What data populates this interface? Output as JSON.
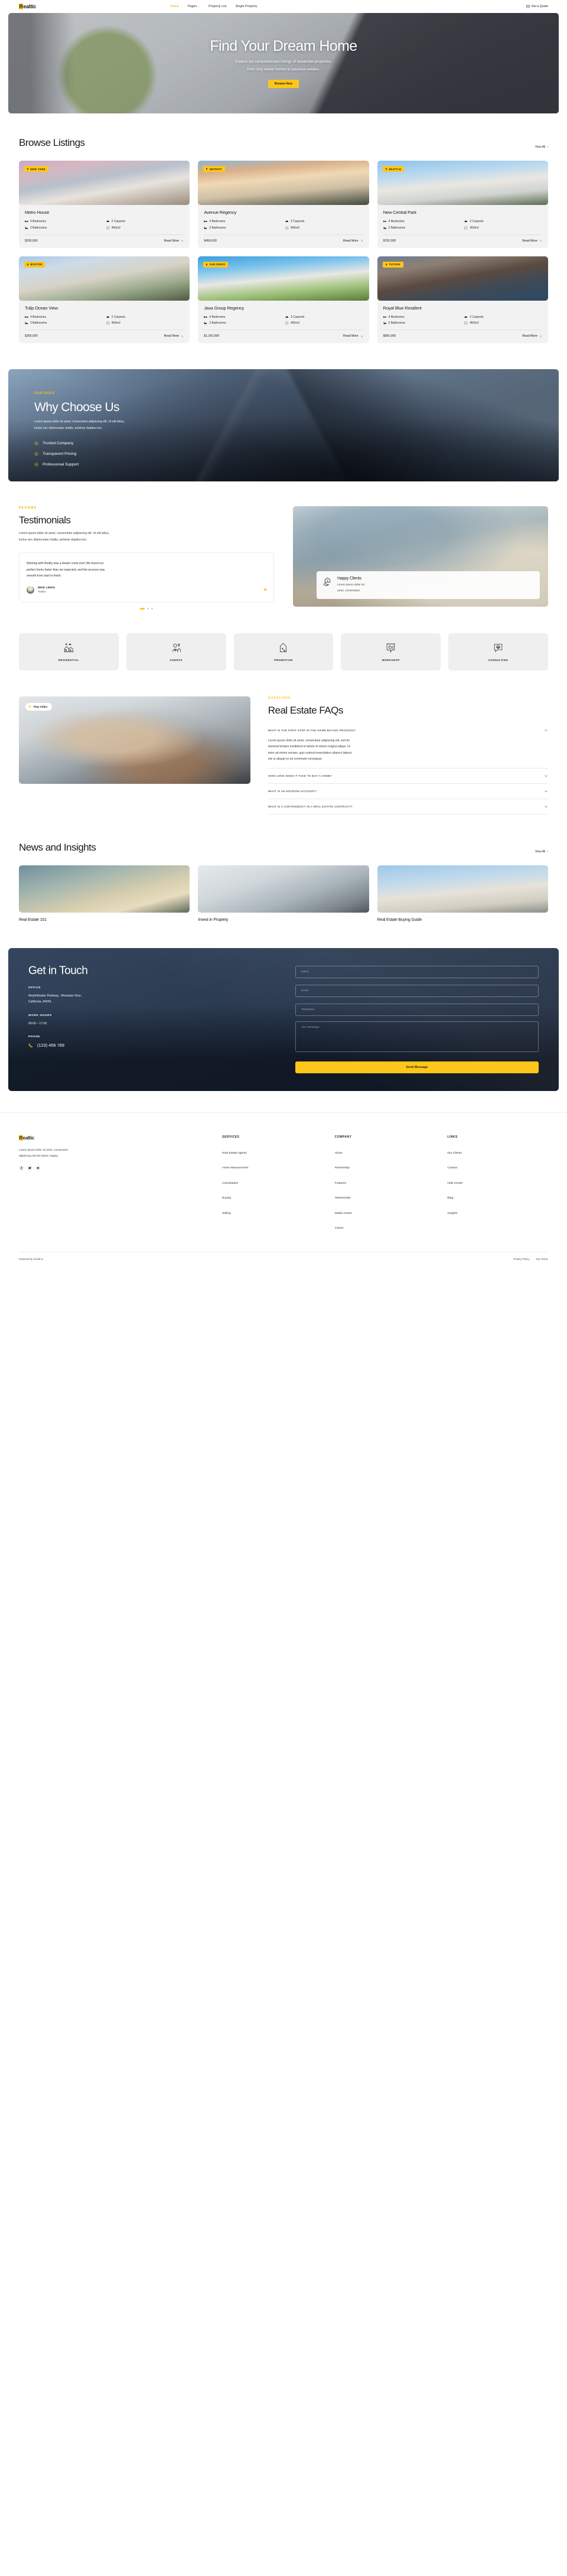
{
  "brand": {
    "name_highlight": "R",
    "name_rest": "ealtic"
  },
  "header": {
    "nav": [
      {
        "label": "Home",
        "active": true
      },
      {
        "label": "Pages",
        "has_caret": true
      },
      {
        "label": "Property List"
      },
      {
        "label": "Single Property"
      }
    ],
    "quote_label": "Get a Quote",
    "quote_icon": "mail-icon"
  },
  "hero": {
    "title": "Find Your Dream Home",
    "subtitle_line1": "Explore our comprehensive listings of residential properties,",
    "subtitle_line2": "from cozy starter homes to luxurious estates.",
    "cta": "Browse Now"
  },
  "listings": {
    "title": "Browse Listings",
    "view_all": "View All",
    "items": [
      {
        "city": "NEW YORK",
        "name": "Metro House",
        "bedrooms": "4 Bedrooms",
        "carports": "2 Carports",
        "bathrooms": "2 Bathrooms",
        "area": "450m2",
        "price": "$250,000",
        "read_more": "Read More"
      },
      {
        "city": "DETROIT",
        "name": "Avenue Regency",
        "bedrooms": "4 Bedrooms",
        "carports": "2 Carports",
        "bathrooms": "2 Bathrooms",
        "area": "450m2",
        "price": "$450,000",
        "read_more": "Read More"
      },
      {
        "city": "SEATTLE",
        "name": "New Central Park",
        "bedrooms": "4 Bedrooms",
        "carports": "2 Carports",
        "bathrooms": "2 Bathrooms",
        "area": "450m2",
        "price": "$700,000",
        "read_more": "Read More"
      },
      {
        "city": "BOSTON",
        "name": "Tulip Ocean View",
        "bedrooms": "4 Bedrooms",
        "carports": "2 Carports",
        "bathrooms": "2 Bathrooms",
        "area": "450m2",
        "price": "$350,000",
        "read_more": "Read More"
      },
      {
        "city": "SAN DIEGO",
        "name": "Java Group Regency",
        "bedrooms": "4 Bedrooms",
        "carports": "2 Carports",
        "bathrooms": "2 Bathrooms",
        "area": "450m2",
        "price": "$1,250,000",
        "read_more": "Read More"
      },
      {
        "city": "TUCSON",
        "name": "Royal Blue Resident",
        "bedrooms": "4 Bedrooms",
        "carports": "2 Carports",
        "bathrooms": "2 Bathrooms",
        "area": "450m2",
        "price": "$950,000",
        "read_more": "Read More"
      }
    ]
  },
  "why": {
    "eyebrow": "FEATURES",
    "title": "Why Choose Us",
    "body_line1": "Lorem ipsum dolor sit amet, consectetur adipiscing elit. Ut elit tellus,",
    "body_line2": "luctus nec ullamcorper mattis, pulvinar dapibus leo.",
    "features": [
      {
        "label": "Trusted Company"
      },
      {
        "label": "Transparent Pricing"
      },
      {
        "label": "Professional Support"
      }
    ]
  },
  "testimonials": {
    "eyebrow": "REVIEWS",
    "title": "Testimonials",
    "body_line1": "Lorem ipsum dolor sit amet, consectetur adipiscing elit. Ut elit tellus,",
    "body_line2": "luctus nec ullamcorper mattis, pulvinar dapibus leo.",
    "card": {
      "quote_line1": "Working with Realty was a dream come true! We found our",
      "quote_line2": "perfect home faster than we expected, and the process was",
      "quote_line3": "smooth from start to finish.",
      "author": "MIKE LEWIS",
      "source": "Twitter"
    },
    "happy": {
      "title": "Happy Clients",
      "text_line1": "Lorem ipsum dolor sit",
      "text_line2": "amet, consectetur.",
      "icon": "house-hand-icon"
    }
  },
  "categories": [
    {
      "label": "RESIDENTIAL",
      "icon": "houses-icon"
    },
    {
      "label": "AGENTS",
      "icon": "agent-icon"
    },
    {
      "label": "PROMOTION",
      "icon": "house-percent-icon"
    },
    {
      "label": "WORKSHOP",
      "icon": "presentation-icon"
    },
    {
      "label": "CONSULTING",
      "icon": "chat-house-icon"
    }
  ],
  "faq": {
    "eyebrow": "QUESTIONS",
    "title": "Real Estate FAQs",
    "play_label": "Play Video",
    "items": [
      {
        "q": "WHAT IS THE FIRST STEP IN THE HOME BUYING PROCESS?",
        "open": true,
        "a_line1": "Lorem ipsum dolor sit amet, consectetur adipiscing elit, sed do",
        "a_line2": "eiusmod tempor incididunt ut labore et dolore magna aliqua. Ut",
        "a_line3": "enim ad minim veniam, quis nostrud exercitation ullamco laboris",
        "a_line4": "nisi ut aliquip ex ea commodo consequat."
      },
      {
        "q": "HOW LONG DOES IT TAKE TO BUY A HOME?",
        "open": false
      },
      {
        "q": "WHAT IS AN ESCROW ACCOUNT?",
        "open": false
      },
      {
        "q": "WHAT IS A CONTINGENCY IN A REAL ESTATE CONTRACT?",
        "open": false
      }
    ]
  },
  "news": {
    "title": "News and Insights",
    "view_all": "View All",
    "items": [
      {
        "title": "Real Estate 101"
      },
      {
        "title": "Invest in Property"
      },
      {
        "title": "Real Estate Buying Guide"
      }
    ]
  },
  "contact": {
    "title": "Get in Touch",
    "office_label": "OFFICE",
    "office_line1": "Amphitheater Parkway , Mountain View ,",
    "office_line2": "California, 94043.",
    "hours_label": "WORK HOURS",
    "hours_value": "09.00 – 17.00",
    "phone_label": "PHONE",
    "phone_value": "(123) 456 789",
    "phone_icon": "phone-icon",
    "form": {
      "name_placeholder": "Name",
      "email_placeholder": "Email",
      "telephone_placeholder": "Telephone",
      "message_placeholder": "Your Message",
      "submit": "Send Message"
    }
  },
  "footer": {
    "about_line1": "Lorem ipsum dolor sit amet, consectetur",
    "about_line2": "adipiscing elit eta dolore magna.",
    "socials": [
      "facebook-icon",
      "twitter-icon",
      "youtube-icon"
    ],
    "columns": [
      {
        "heading": "SERVICES",
        "links": [
          "Real Estate Agents",
          "Home Measurement",
          "Consultation",
          "Buying",
          "Selling"
        ]
      },
      {
        "heading": "COMPANY",
        "links": [
          "About",
          "Partnership",
          "Features",
          "Testimonials",
          "Media Center",
          "Career"
        ]
      },
      {
        "heading": "LINKS",
        "links": [
          "Our Clients",
          "Contact",
          "Help Center",
          "Blog",
          "Insights"
        ]
      }
    ],
    "copyright": "Powered by Sociid.io",
    "bottom_links": [
      "Privacy Policy",
      "Our Terms"
    ]
  },
  "colors": {
    "accent": "#FFC61A",
    "dark": "#1a1a1a",
    "navy": "#2c3c52"
  }
}
